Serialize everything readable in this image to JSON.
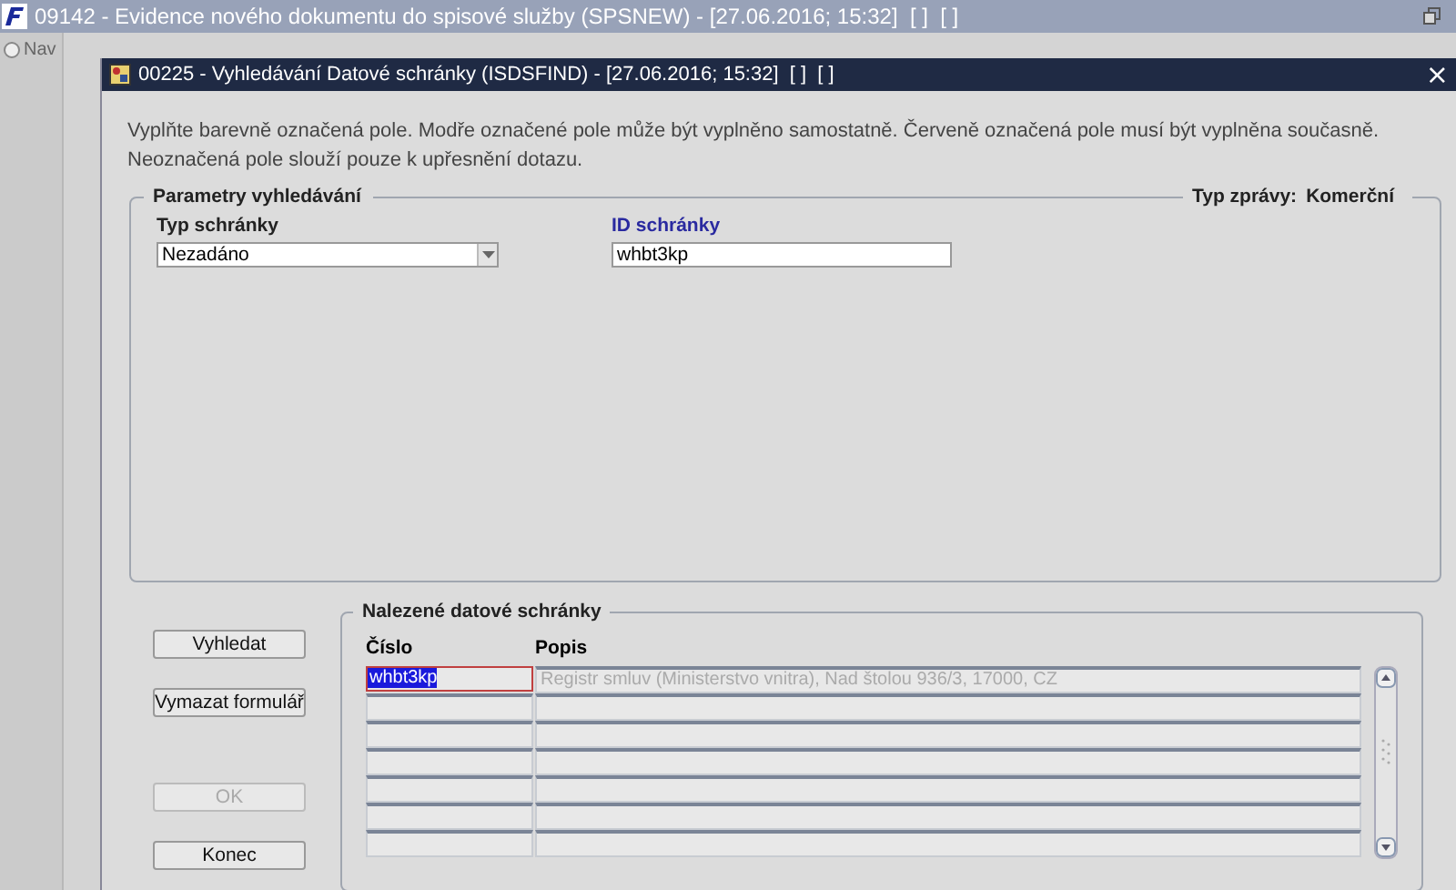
{
  "app_window": {
    "title": "09142 - Evidence nového dokumentu do spisové služby (SPSNEW) - [27.06.2016; 15:32]  [ ]  [ ]",
    "nav_item": {
      "label": "Nav",
      "selected": false
    }
  },
  "dialog": {
    "title": "00225 - Vyhledávání Datové schránky (ISDSFIND) - [27.06.2016; 15:32]  [ ]  [ ]",
    "close": "×",
    "instructions": [
      "Vyplňte barevně označená pole. Modře označené pole může být vyplněno samostatně. Červeně označená pole musí být vyplněna současně.",
      "Neoznačená pole slouží pouze k upřesnění dotazu."
    ],
    "search_params": {
      "legend": "Parametry vyhledávání",
      "message_type_label": "Typ zprávy:",
      "message_type_value": "Komerční",
      "mailbox_type": {
        "label": "Typ schránky",
        "value": "Nezadáno"
      },
      "mailbox_id": {
        "label": "ID schránky",
        "value": "whbt3kp"
      }
    },
    "buttons": [
      {
        "label": "Vyhledat",
        "disabled": false
      },
      {
        "label": "Vymazat formulář",
        "disabled": false
      },
      {
        "label": "OK",
        "disabled": true
      },
      {
        "label": "Konec",
        "disabled": false
      }
    ],
    "results": {
      "legend": "Nalezené datové schránky",
      "columns": [
        "Číslo",
        "Popis"
      ],
      "rows": [
        {
          "number": "whbt3kp",
          "description": "Registr smluv (Ministerstvo vnitra), Nad štolou 936/3, 17000, CZ",
          "selected": true
        }
      ]
    }
  }
}
